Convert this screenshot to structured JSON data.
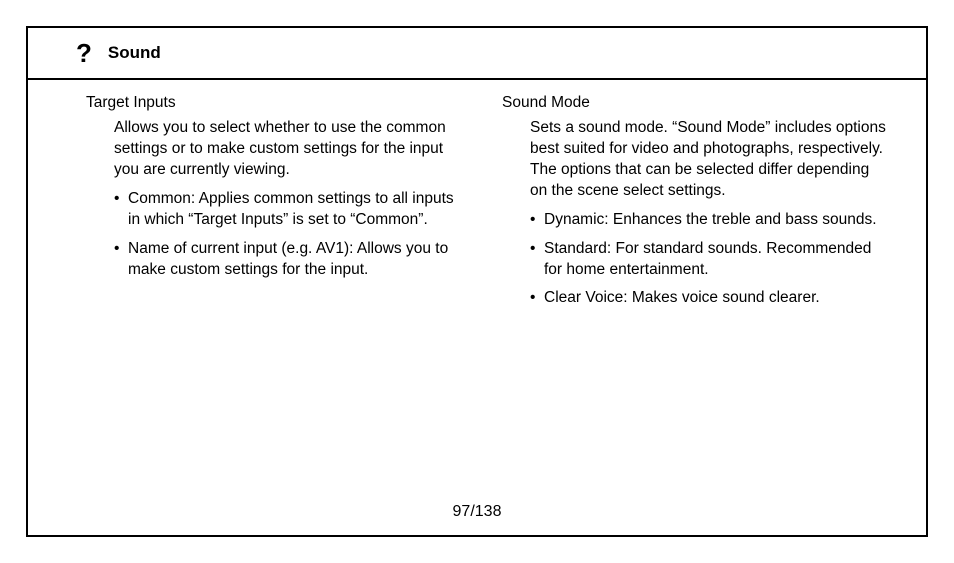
{
  "header": {
    "icon": "?",
    "title": "Sound"
  },
  "left": {
    "heading": "Target Inputs",
    "description": "Allows you to select whether to use the common settings or to make custom settings for the input you are currently viewing.",
    "bullets": [
      "Common: Applies common settings to all inputs in which “Target Inputs” is set to “Common”.",
      "Name of current input (e.g. AV1): Allows you to make custom settings for the input."
    ]
  },
  "right": {
    "heading": "Sound Mode",
    "description": "Sets a sound mode. “Sound Mode” includes options best suited for video and photographs, respectively. The options that can be selected differ depending on the scene select settings.",
    "bullets": [
      "Dynamic: Enhances the treble and bass sounds.",
      "Standard: For standard sounds. Recommended for home entertainment.",
      "Clear Voice: Makes voice sound clearer."
    ]
  },
  "pagination": "97/138"
}
